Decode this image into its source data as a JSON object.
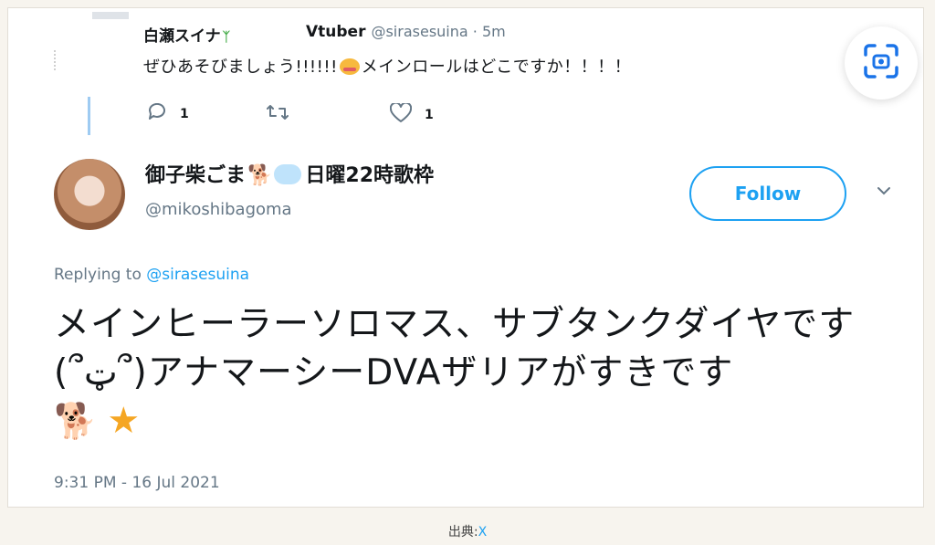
{
  "parent_tweet": {
    "display_name": "白瀬スイナ",
    "category": "Vtuber",
    "handle": "@sirasesuina",
    "time_ago": "· 5m",
    "text_part1": "ぜひあそびましょう!!!!!!",
    "text_part2": "メインロールはどこですか！！！！",
    "reply_count": "1",
    "like_count": "1"
  },
  "reply_tweet": {
    "display_name_part1": "御子柴ごま",
    "display_name_part2": "日曜22時歌枠",
    "handle": "@mikoshibagoma",
    "follow_label": "Follow",
    "replying_prefix": "Replying to",
    "replying_handle": "@sirasesuina",
    "text": "メインヒーラーソロマス、サブタンクダイヤです(՞ټ՞)アナマーシーDVAザリアがすきです",
    "timestamp": "9:31 PM - 16 Jul 2021"
  },
  "icons": {
    "scan": "screen-scan-icon",
    "reply": "reply-icon",
    "retweet": "retweet-icon",
    "like": "heart-icon",
    "chevron": "chevron-down-icon"
  },
  "colors": {
    "accent": "#1da1f2",
    "text": "#14171a",
    "muted": "#657786"
  },
  "source": {
    "label": "出典:",
    "link": "X"
  }
}
